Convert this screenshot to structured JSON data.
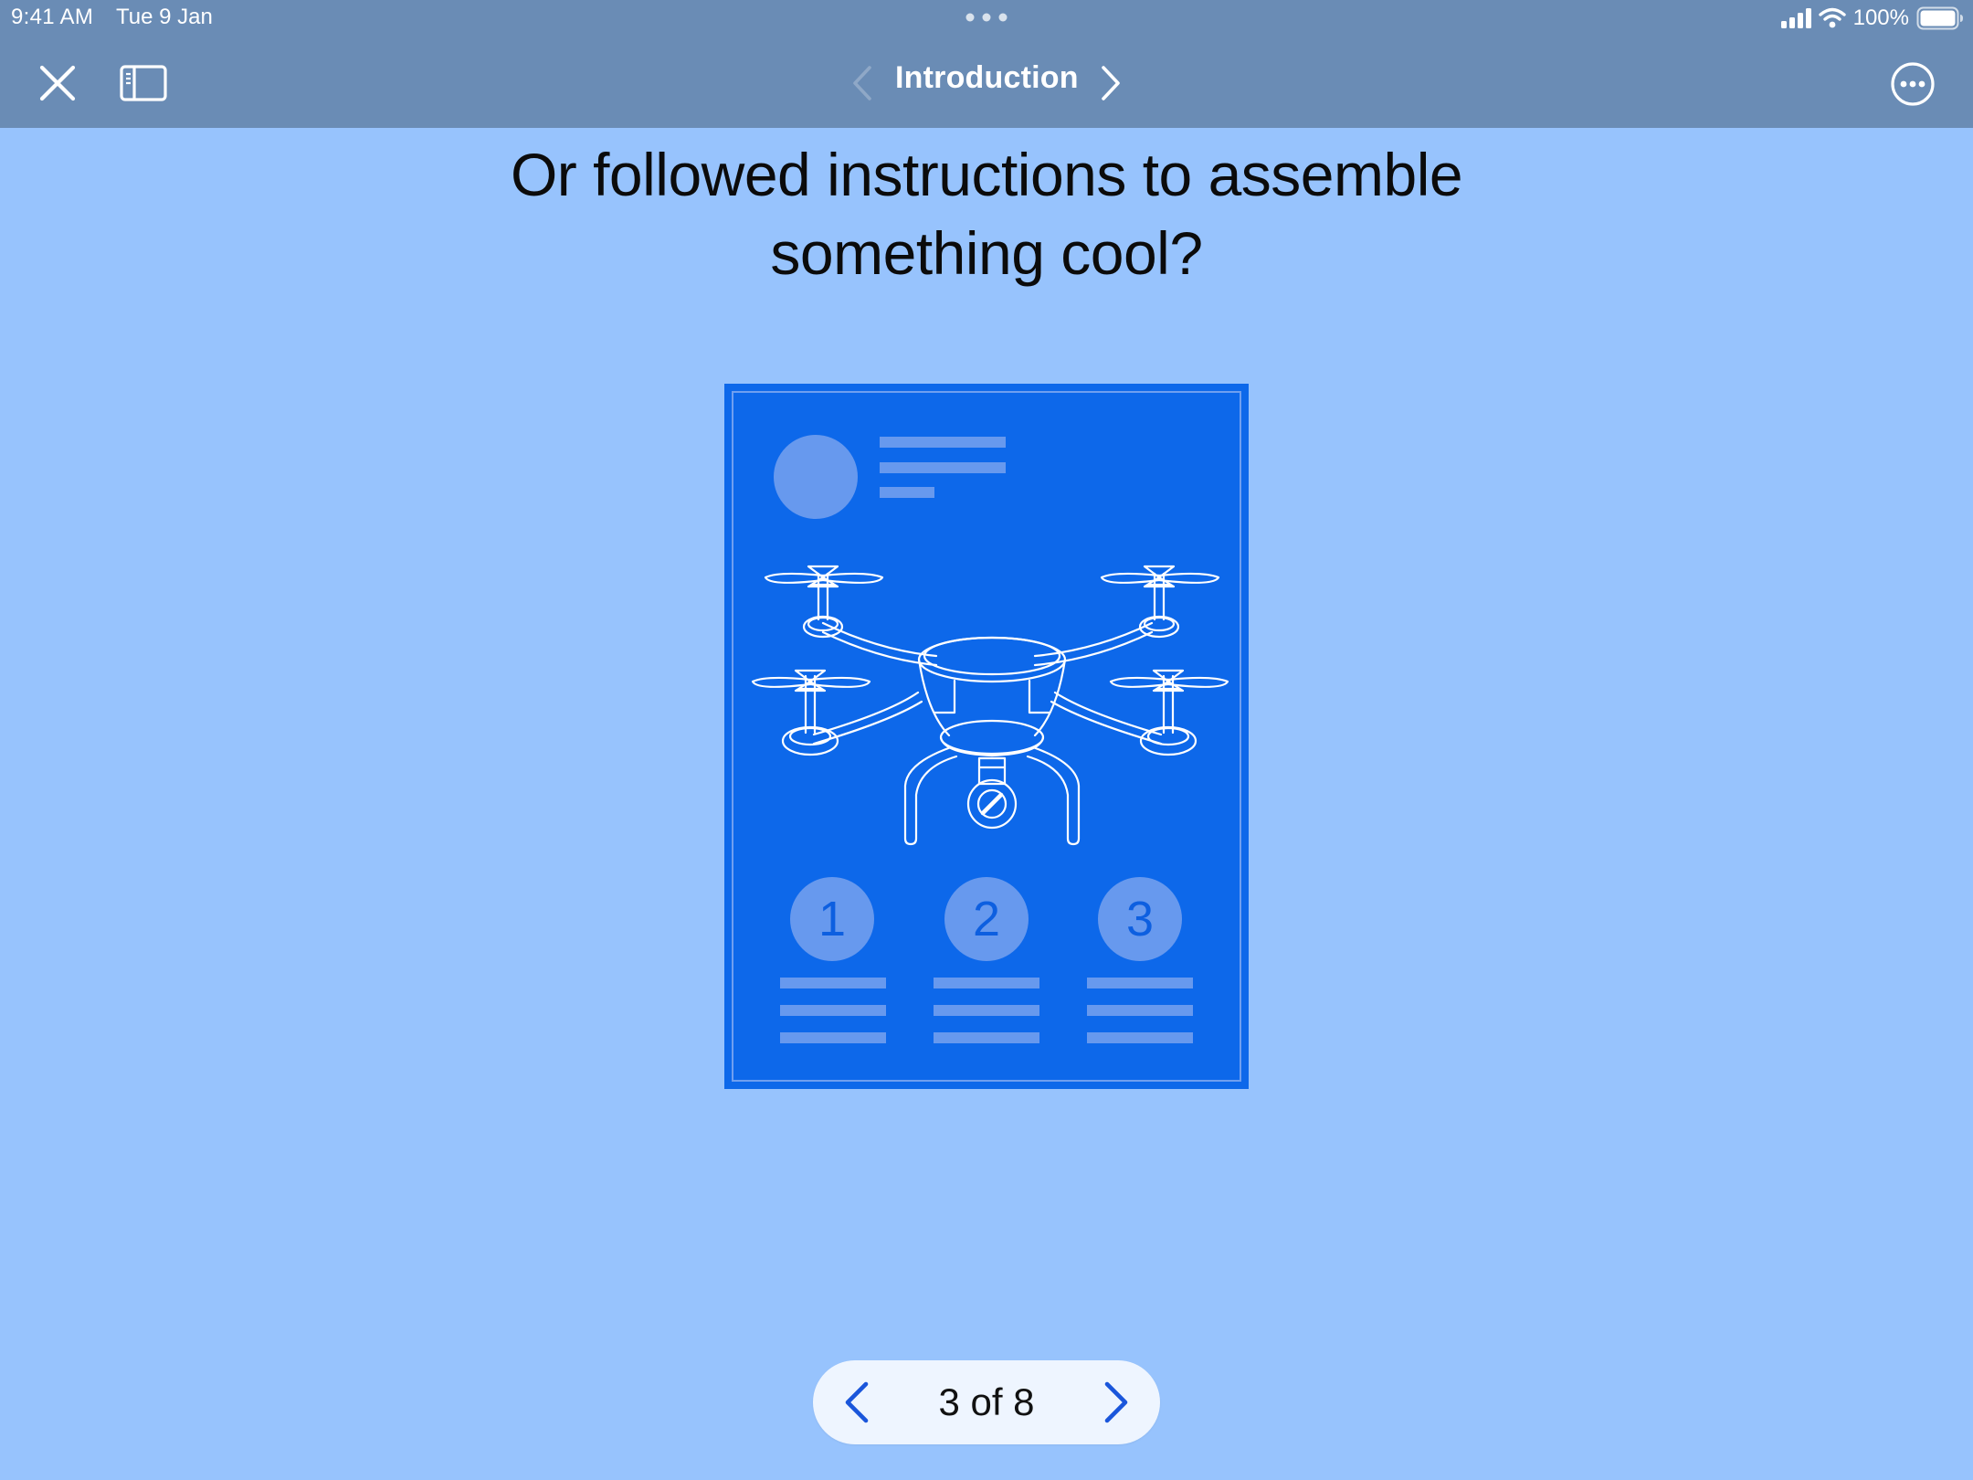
{
  "status_bar": {
    "time": "9:41 AM",
    "date": "Tue 9 Jan",
    "battery": "100%"
  },
  "nav_bar": {
    "title": "Introduction",
    "close_icon": "close-icon",
    "sidebar_icon": "sidebar-icon",
    "prev_icon": "chevron-left-icon",
    "next_icon": "chevron-right-icon",
    "more_icon": "more-icon"
  },
  "content": {
    "heading_line1": "Or followed instructions to assemble",
    "heading_line2": "something cool?",
    "illustration": {
      "subject": "drone assembly instructions",
      "steps": [
        "1",
        "2",
        "3"
      ]
    }
  },
  "pager": {
    "label": "3 of 8",
    "current": 3,
    "total": 8
  },
  "colors": {
    "background": "#97c3fd",
    "topbar": "#6a8cb5",
    "illustration_fill": "#0d68ea",
    "accent": "#1a56db"
  }
}
